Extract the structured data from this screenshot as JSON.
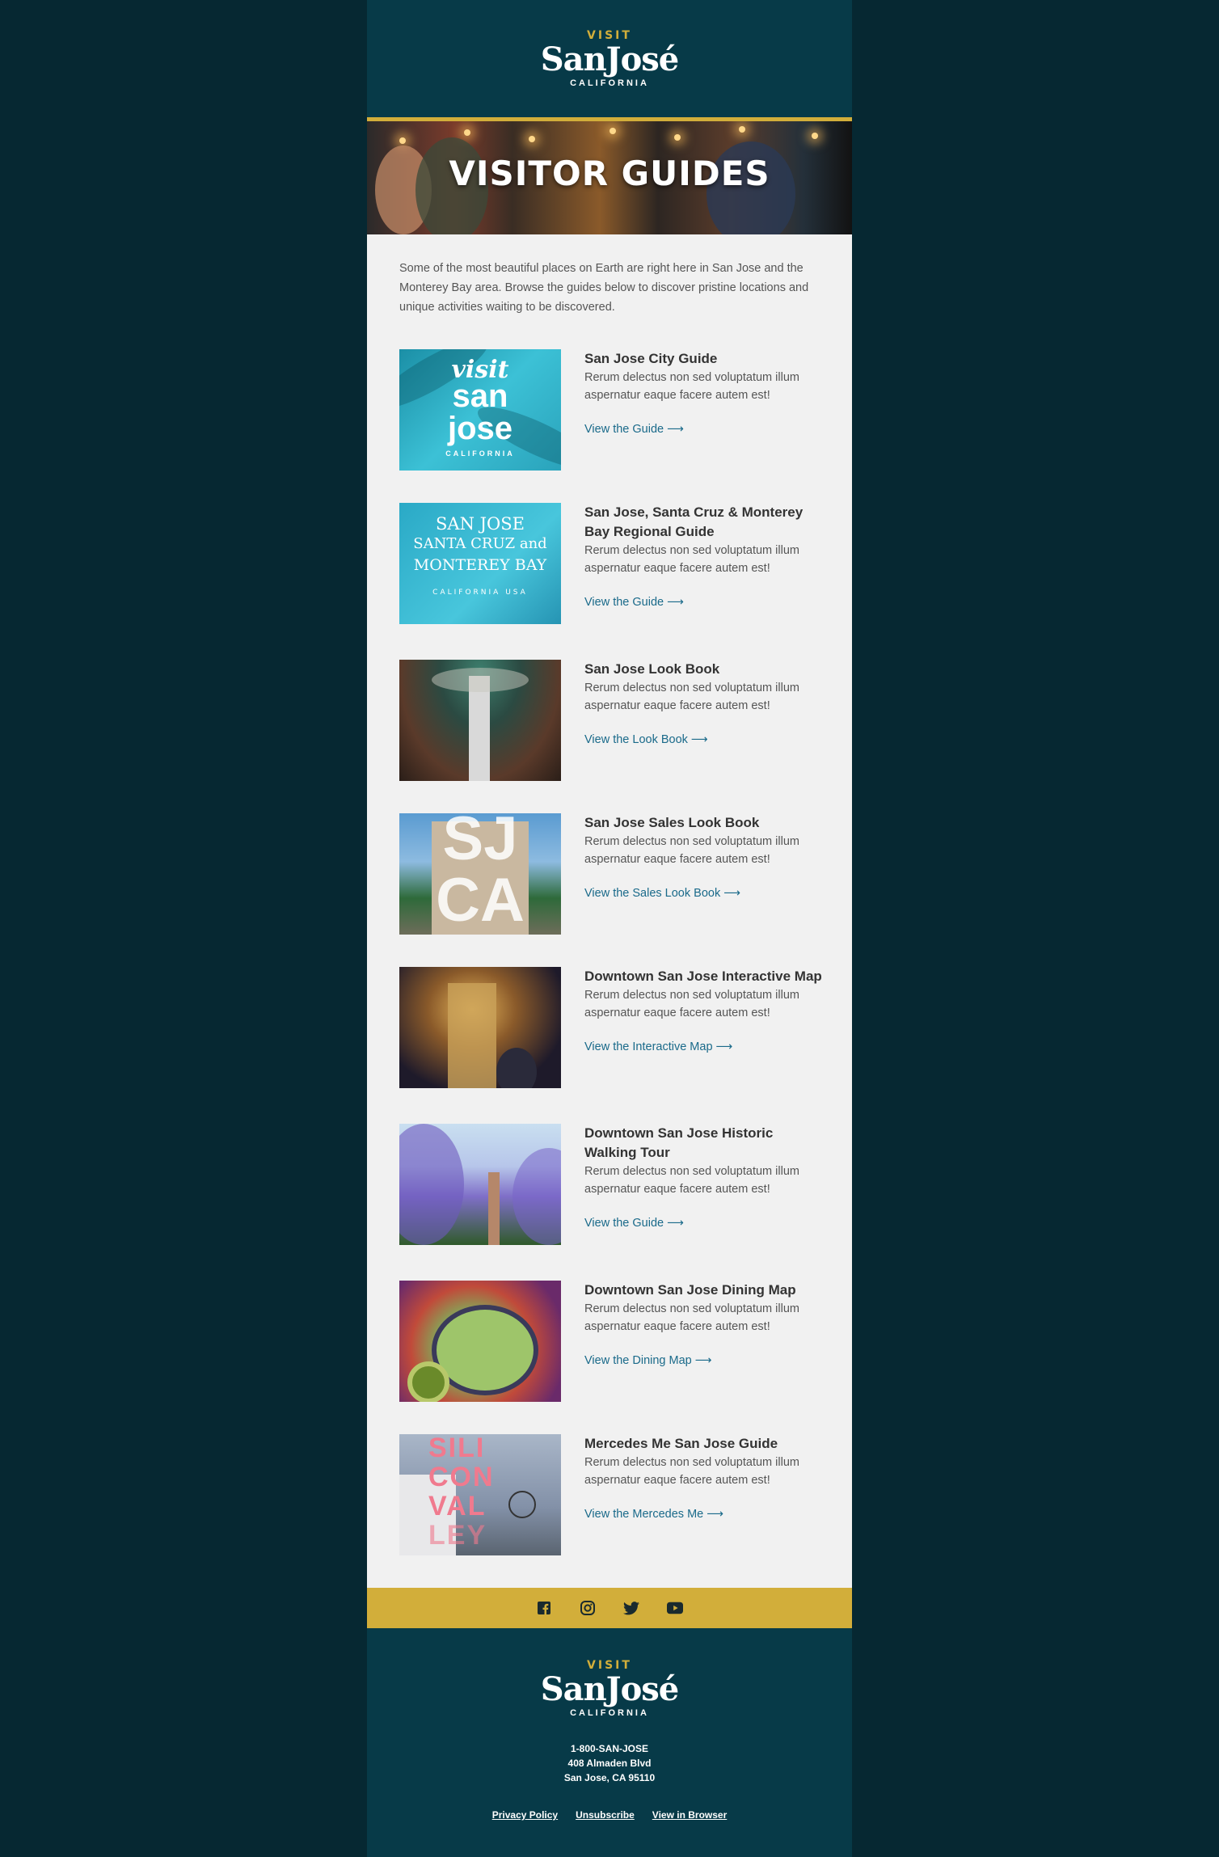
{
  "header": {
    "logo": {
      "visit": "VISIT",
      "name": "SanJosé",
      "state": "CALIFORNIA"
    }
  },
  "hero": {
    "title": "VISITOR GUIDES"
  },
  "intro": "Some of the most beautiful places on Earth are right here in San Jose and the Monterey Bay area. Browse the guides below to discover pristine locations and unique activities waiting to be discovered.",
  "guides": [
    {
      "title": "San Jose City Guide",
      "desc": "Rerum delectus non sed voluptatum illum aspernatur eaque facere autem est!",
      "link": "View the Guide",
      "thumb_text": [
        "visit",
        "san",
        "jose",
        "CALIFORNIA"
      ]
    },
    {
      "title": "San Jose, Santa Cruz & Monterey Bay Regional Guide",
      "desc": "Rerum delectus non sed voluptatum illum aspernatur eaque facere autem est!",
      "link": "View the Guide",
      "thumb_text": [
        "SAN JOSE",
        "SANTA CRUZ and",
        "MONTEREY BAY",
        "CALIFORNIA USA"
      ]
    },
    {
      "title": "San Jose Look Book",
      "desc": "Rerum delectus non sed voluptatum illum aspernatur eaque facere autem est!",
      "link": "View the Look Book"
    },
    {
      "title": "San Jose Sales Look Book",
      "desc": "Rerum delectus non sed voluptatum illum aspernatur eaque facere autem est!",
      "link": "View the Sales Look Book",
      "thumb_text": [
        "SJ",
        "CA"
      ]
    },
    {
      "title": "Downtown San Jose Interactive Map",
      "desc": "Rerum delectus non sed voluptatum illum aspernatur eaque facere autem est!",
      "link": "View the Interactive Map"
    },
    {
      "title": "Downtown San Jose Historic Walking Tour",
      "desc": "Rerum delectus non sed voluptatum illum aspernatur eaque facere autem est!",
      "link": "View the Guide"
    },
    {
      "title": "Downtown San Jose Dining Map",
      "desc": "Rerum delectus non sed voluptatum illum aspernatur eaque facere autem est!",
      "link": "View the Dining Map"
    },
    {
      "title": "Mercedes Me San Jose Guide",
      "desc": "Rerum delectus non sed voluptatum illum aspernatur eaque facere autem est!",
      "link": "View the Mercedes Me",
      "thumb_text": [
        "SILI",
        "CON",
        "VAL",
        "LEY"
      ]
    }
  ],
  "link_arrow": "⟶",
  "social": [
    "facebook-icon",
    "instagram-icon",
    "twitter-icon",
    "youtube-icon"
  ],
  "footer": {
    "logo": {
      "visit": "VISIT",
      "name": "SanJosé",
      "state": "CALIFORNIA"
    },
    "phone": "1-800-SAN-JOSE",
    "address1": "408 Almaden Blvd",
    "address2": "San Jose, CA 95110",
    "links": [
      "Privacy Policy",
      "Unsubscribe",
      "View in Browser"
    ]
  },
  "colors": {
    "teal": "#073a48",
    "gold": "#d2ae3a",
    "link": "#1a6a8a",
    "background": "#062832"
  }
}
